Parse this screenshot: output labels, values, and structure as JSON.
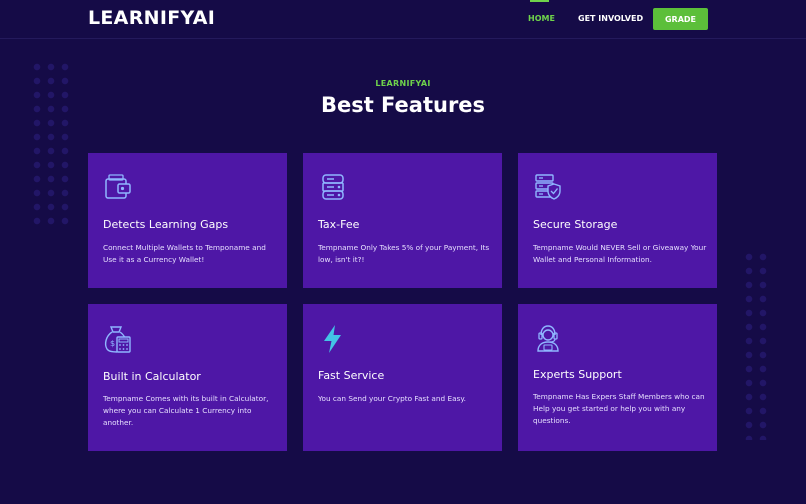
{
  "colors": {
    "background": "#150b47",
    "card": "#4e17a6",
    "accent_green": "#6fd34b",
    "button_green": "#5cbf3a",
    "icon_blue": "#8fb6ff",
    "lightning": "#43c4e6"
  },
  "header": {
    "logo": "LEARNIFYAI",
    "nav": [
      {
        "label": "HOME",
        "active": true
      },
      {
        "label": "GET INVOLVED",
        "active": false
      }
    ],
    "cta_label": "GRADE"
  },
  "section": {
    "eyebrow": "LEARNIFYAI",
    "title": "Best Features"
  },
  "features": [
    {
      "icon": "wallet-icon",
      "title": "Detects Learning Gaps",
      "desc": "Connect Multiple Wallets to Temponame and Use it as a Currency Wallet!"
    },
    {
      "icon": "database-icon",
      "title": "Tax-Fee",
      "desc": "Tempname Only Takes 5% of your Payment, Its low, isn't it?!"
    },
    {
      "icon": "secure-server-icon",
      "title": "Secure Storage",
      "desc": "Tempname Would NEVER Sell or Giveaway Your Wallet and Personal Information."
    },
    {
      "icon": "money-bag-calculator-icon",
      "title": "Built in Calculator",
      "desc": "Tempname Comes with its built in Calculator, where you can Calculate 1 Currency into another."
    },
    {
      "icon": "lightning-icon",
      "title": "Fast Service",
      "desc": "You can Send your Crypto Fast and Easy."
    },
    {
      "icon": "support-agent-icon",
      "title": "Experts Support",
      "desc": "Tempname Has Expers Staff Members who can Help you get started or help you with any questions."
    }
  ]
}
